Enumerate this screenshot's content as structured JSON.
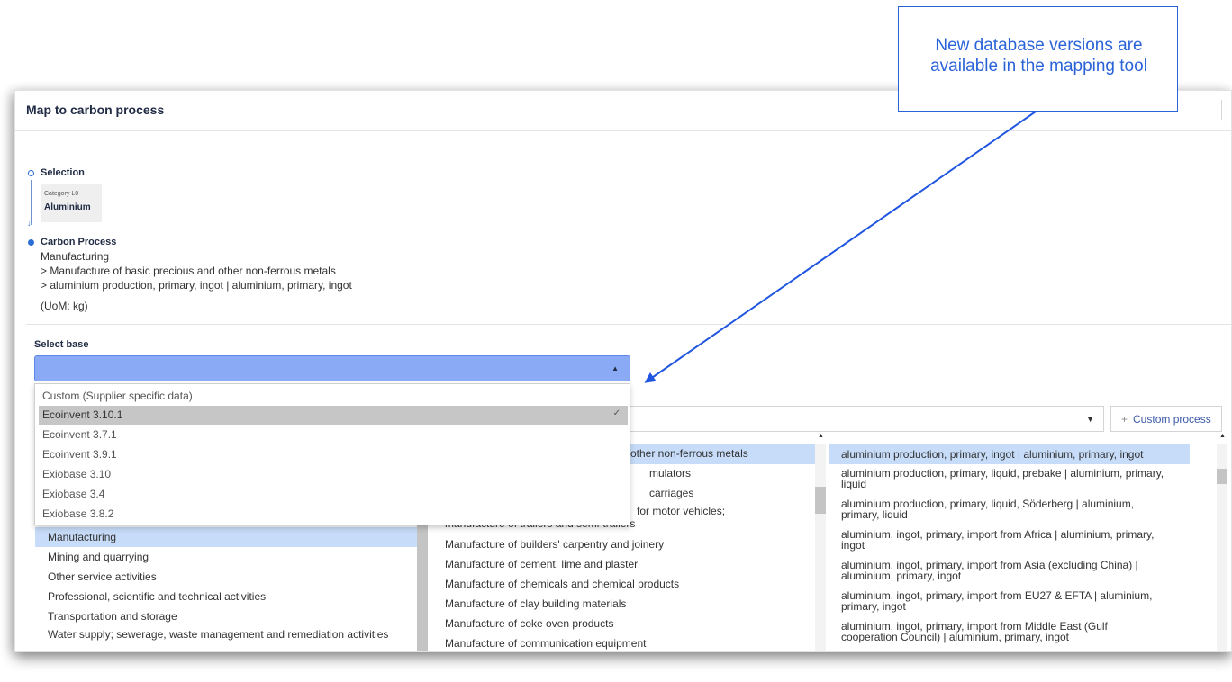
{
  "dialog": {
    "title": "Map to carbon process"
  },
  "selection": {
    "label": "Selection",
    "category_label": "Category L0",
    "category_value": "Aluminium"
  },
  "carbon_process": {
    "title": "Carbon Process",
    "lines": [
      "Manufacturing",
      "> Manufacture of basic precious and other non-ferrous metals",
      "> aluminium production, primary, ingot | aluminium, primary, ingot"
    ],
    "uom": "(UoM: kg)"
  },
  "select_base": {
    "label": "Select base",
    "options": [
      "Custom (Supplier specific data)",
      "Ecoinvent 3.10.1",
      "Ecoinvent 3.7.1",
      "Ecoinvent 3.9.1",
      "Exiobase 3.10",
      "Exiobase 3.4",
      "Exiobase 3.8.2"
    ],
    "selected_check": "✓"
  },
  "toolbar": {
    "custom_process_label": "Custom process",
    "plus": "+",
    "caret": "▼",
    "up_caret": "▲"
  },
  "columns": {
    "sectors": [
      "Manufacturing",
      "Mining and quarrying",
      "Other service activities",
      "Professional, scientific and technical activities",
      "Transportation and storage",
      "Water supply; sewerage, waste management and remediation activities"
    ],
    "subsectors_hidden": [
      "other non-ferrous metals",
      "mulators",
      "carriages",
      "for motor vehicles;"
    ],
    "subsectors": [
      "manufacture of trailers and semi-trailers",
      "Manufacture of builders' carpentry and joinery",
      "Manufacture of cement, lime and plaster",
      "Manufacture of chemicals and chemical products",
      "Manufacture of clay building materials",
      "Manufacture of coke oven products",
      "Manufacture of communication equipment"
    ],
    "processes": [
      "aluminium production, primary, ingot | aluminium, primary, ingot",
      "aluminium production, primary, liquid, prebake | aluminium, primary, liquid",
      "aluminium production, primary, liquid, Söderberg | aluminium, primary, liquid",
      "aluminium, ingot, primary, import from Africa | aluminium, primary, ingot",
      "aluminium, ingot, primary, import from Asia (excluding China) | aluminium, primary, ingot",
      "aluminium, ingot, primary, import from EU27 & EFTA | aluminium, primary, ingot",
      "aluminium, ingot, primary, import from Middle East (Gulf cooperation Council) | aluminium, primary, ingot"
    ]
  },
  "callout": {
    "text": "New database versions are available in the mapping tool"
  },
  "colors": {
    "accent": "#2a63d8",
    "select_fill": "#8aaaf5",
    "row_highlight": "#c6dcf8"
  }
}
